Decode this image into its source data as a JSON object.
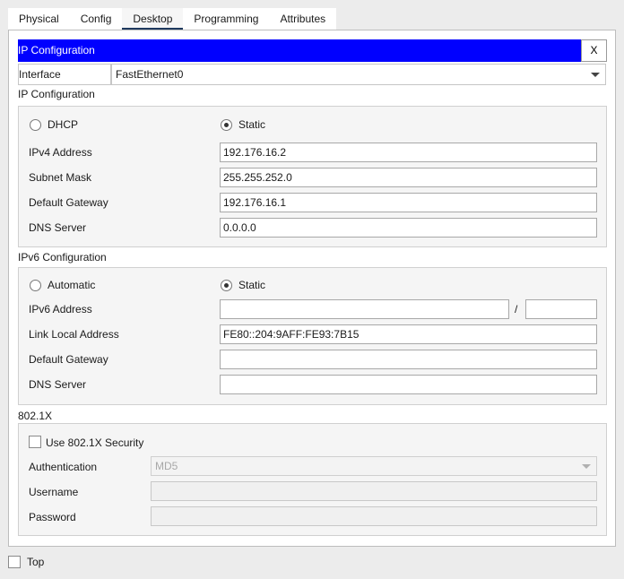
{
  "tabs": [
    "Physical",
    "Config",
    "Desktop",
    "Programming",
    "Attributes"
  ],
  "active_tab": "Desktop",
  "window": {
    "title": "IP Configuration",
    "close_label": "X",
    "titlebar_color": "#0000ff"
  },
  "interface": {
    "label": "Interface",
    "value": "FastEthernet0"
  },
  "ipv4": {
    "section_label": "IP Configuration",
    "dhcp_label": "DHCP",
    "static_label": "Static",
    "mode": "Static",
    "address_label": "IPv4 Address",
    "address": "192.176.16.2",
    "mask_label": "Subnet Mask",
    "mask": "255.255.252.0",
    "gateway_label": "Default Gateway",
    "gateway": "192.176.16.1",
    "dns_label": "DNS Server",
    "dns": "0.0.0.0"
  },
  "ipv6": {
    "section_label": "IPv6 Configuration",
    "auto_label": "Automatic",
    "static_label": "Static",
    "mode": "Static",
    "address_label": "IPv6 Address",
    "address": "",
    "prefix_separator": "/",
    "prefix": "",
    "link_local_label": "Link Local Address",
    "link_local": "FE80::204:9AFF:FE93:7B15",
    "gateway_label": "Default Gateway",
    "gateway": "",
    "dns_label": "DNS Server",
    "dns": ""
  },
  "dot1x": {
    "section_label": "802.1X",
    "use_label": "Use 802.1X Security",
    "enabled": false,
    "auth_label": "Authentication",
    "auth_value": "MD5",
    "username_label": "Username",
    "username": "",
    "password_label": "Password",
    "password": ""
  },
  "top": {
    "label": "Top",
    "checked": false
  }
}
